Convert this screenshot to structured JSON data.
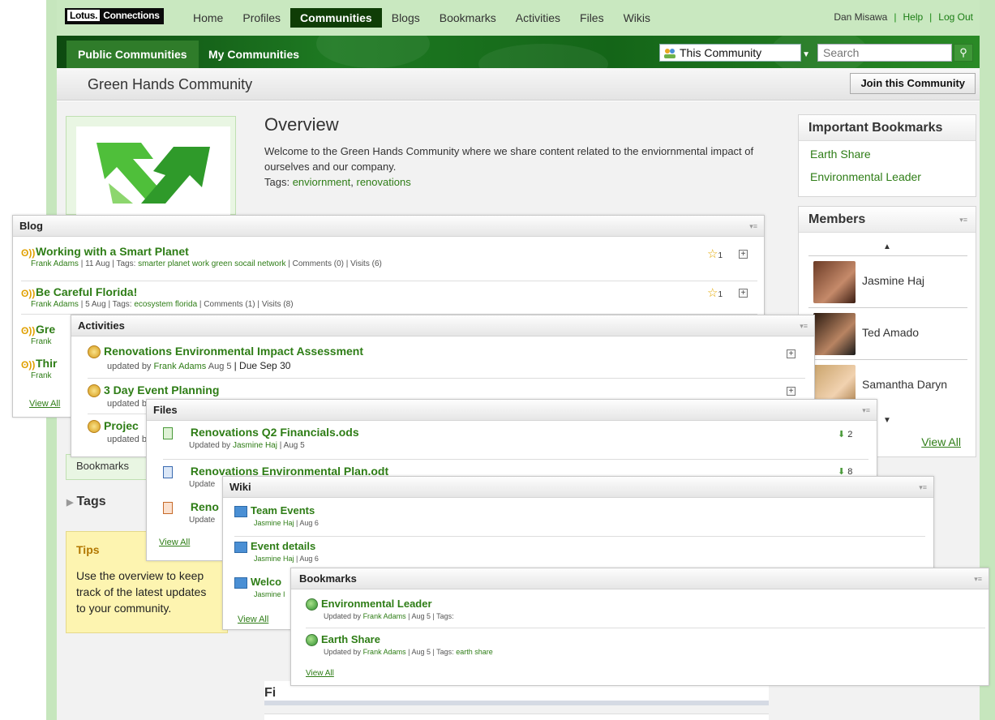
{
  "topnav": {
    "logo_lotus": "Lotus.",
    "logo_connections": "Connections",
    "items": [
      "Home",
      "Profiles",
      "Communities",
      "Blogs",
      "Bookmarks",
      "Activities",
      "Files",
      "Wikis"
    ],
    "active": "Communities",
    "user": "Dan Misawa",
    "help": "Help",
    "logout": "Log Out"
  },
  "subnav": {
    "tabs": [
      "Public Communities",
      "My Communities"
    ],
    "scope": "This Community",
    "search_placeholder": "Search"
  },
  "community": {
    "title": "Green Hands Community",
    "join_label": "Join this Community"
  },
  "overview": {
    "heading": "Overview",
    "description": "Welcome to the Green Hands Community where we share content related to the enviornmental impact of ourselves and our company.",
    "tags_label": "Tags:",
    "tags": [
      "enviornment",
      "renovations"
    ]
  },
  "important_bookmarks": {
    "title": "Important Bookmarks",
    "items": [
      "Earth Share",
      "Environmental Leader"
    ]
  },
  "members": {
    "title": "Members",
    "items": [
      "Jasmine Haj",
      "Ted Amado",
      "Samantha Daryn"
    ],
    "view_all": "View All"
  },
  "sidebar": {
    "bookmarks_label": "Bookmarks",
    "tags_label": "Tags",
    "tips_title": "Tips",
    "tips_body": "Use the overview to keep track of the latest updates to your community."
  },
  "blog": {
    "title": "Blog",
    "entries": [
      {
        "title": "Working with a Smart Planet",
        "author": "Frank Adams",
        "date": "11 Aug",
        "tags": "smarter planet work green socail network",
        "comments": "Comments (0)",
        "visits": "Visits (6)",
        "stars": "1"
      },
      {
        "title": "Be Careful Florida!",
        "author": "Frank Adams",
        "date": "5 Aug",
        "tags": "ecosystem florida",
        "comments": "Comments (1)",
        "visits": "Visits (8)",
        "stars": "1"
      },
      {
        "title": "Gre",
        "author": "Frank"
      },
      {
        "title": "Thir",
        "author": "Frank"
      }
    ],
    "view_all": "View All"
  },
  "activities": {
    "title": "Activities",
    "entries": [
      {
        "title": "Renovations Environmental Impact Assessment",
        "meta_prefix": "updated by",
        "author": "Frank Adams",
        "date": "Aug 5",
        "due": "| Due Sep 30"
      },
      {
        "title": "3 Day Event Planning",
        "meta_prefix": "updated b"
      },
      {
        "title": "Projec",
        "meta_prefix": "updated b"
      }
    ]
  },
  "files": {
    "title": "Files",
    "entries": [
      {
        "title": "Renovations Q2 Financials.ods",
        "meta": "Updated by",
        "author": "Jasmine Haj",
        "date": "Aug 5",
        "downloads": "2"
      },
      {
        "title": "Renovations Environmental Plan.odt",
        "meta": "Update",
        "downloads": "8"
      },
      {
        "title": "Reno",
        "meta": "Update"
      }
    ],
    "view_all": "View All"
  },
  "wiki": {
    "title": "Wiki",
    "entries": [
      {
        "title": "Team Events",
        "author": "Jasmine Haj",
        "date": "Aug 6"
      },
      {
        "title": "Event details",
        "author": "Jasmine Haj",
        "date": "Aug 6"
      },
      {
        "title": "Welco",
        "author": "Jasmine I"
      }
    ],
    "view_all": "View All"
  },
  "bookmarks": {
    "title": "Bookmarks",
    "entries": [
      {
        "title": "Environmental Leader",
        "prefix": "Updated by",
        "author": "Frank Adams",
        "date": "Aug 5",
        "tags_label": "Tags:",
        "tags": ""
      },
      {
        "title": "Earth Share",
        "prefix": "Updated by",
        "author": "Frank Adams",
        "date": "Aug 5",
        "tags_label": "Tags:",
        "tags": "earth  share"
      }
    ],
    "view_all": "View All"
  },
  "bottom_section": "Fi",
  "colors": {
    "brand_green": "#2e7d16",
    "nav_active": "#0f3d06",
    "banner": "#1e7a22",
    "tips_bg": "#fdf4b0"
  }
}
